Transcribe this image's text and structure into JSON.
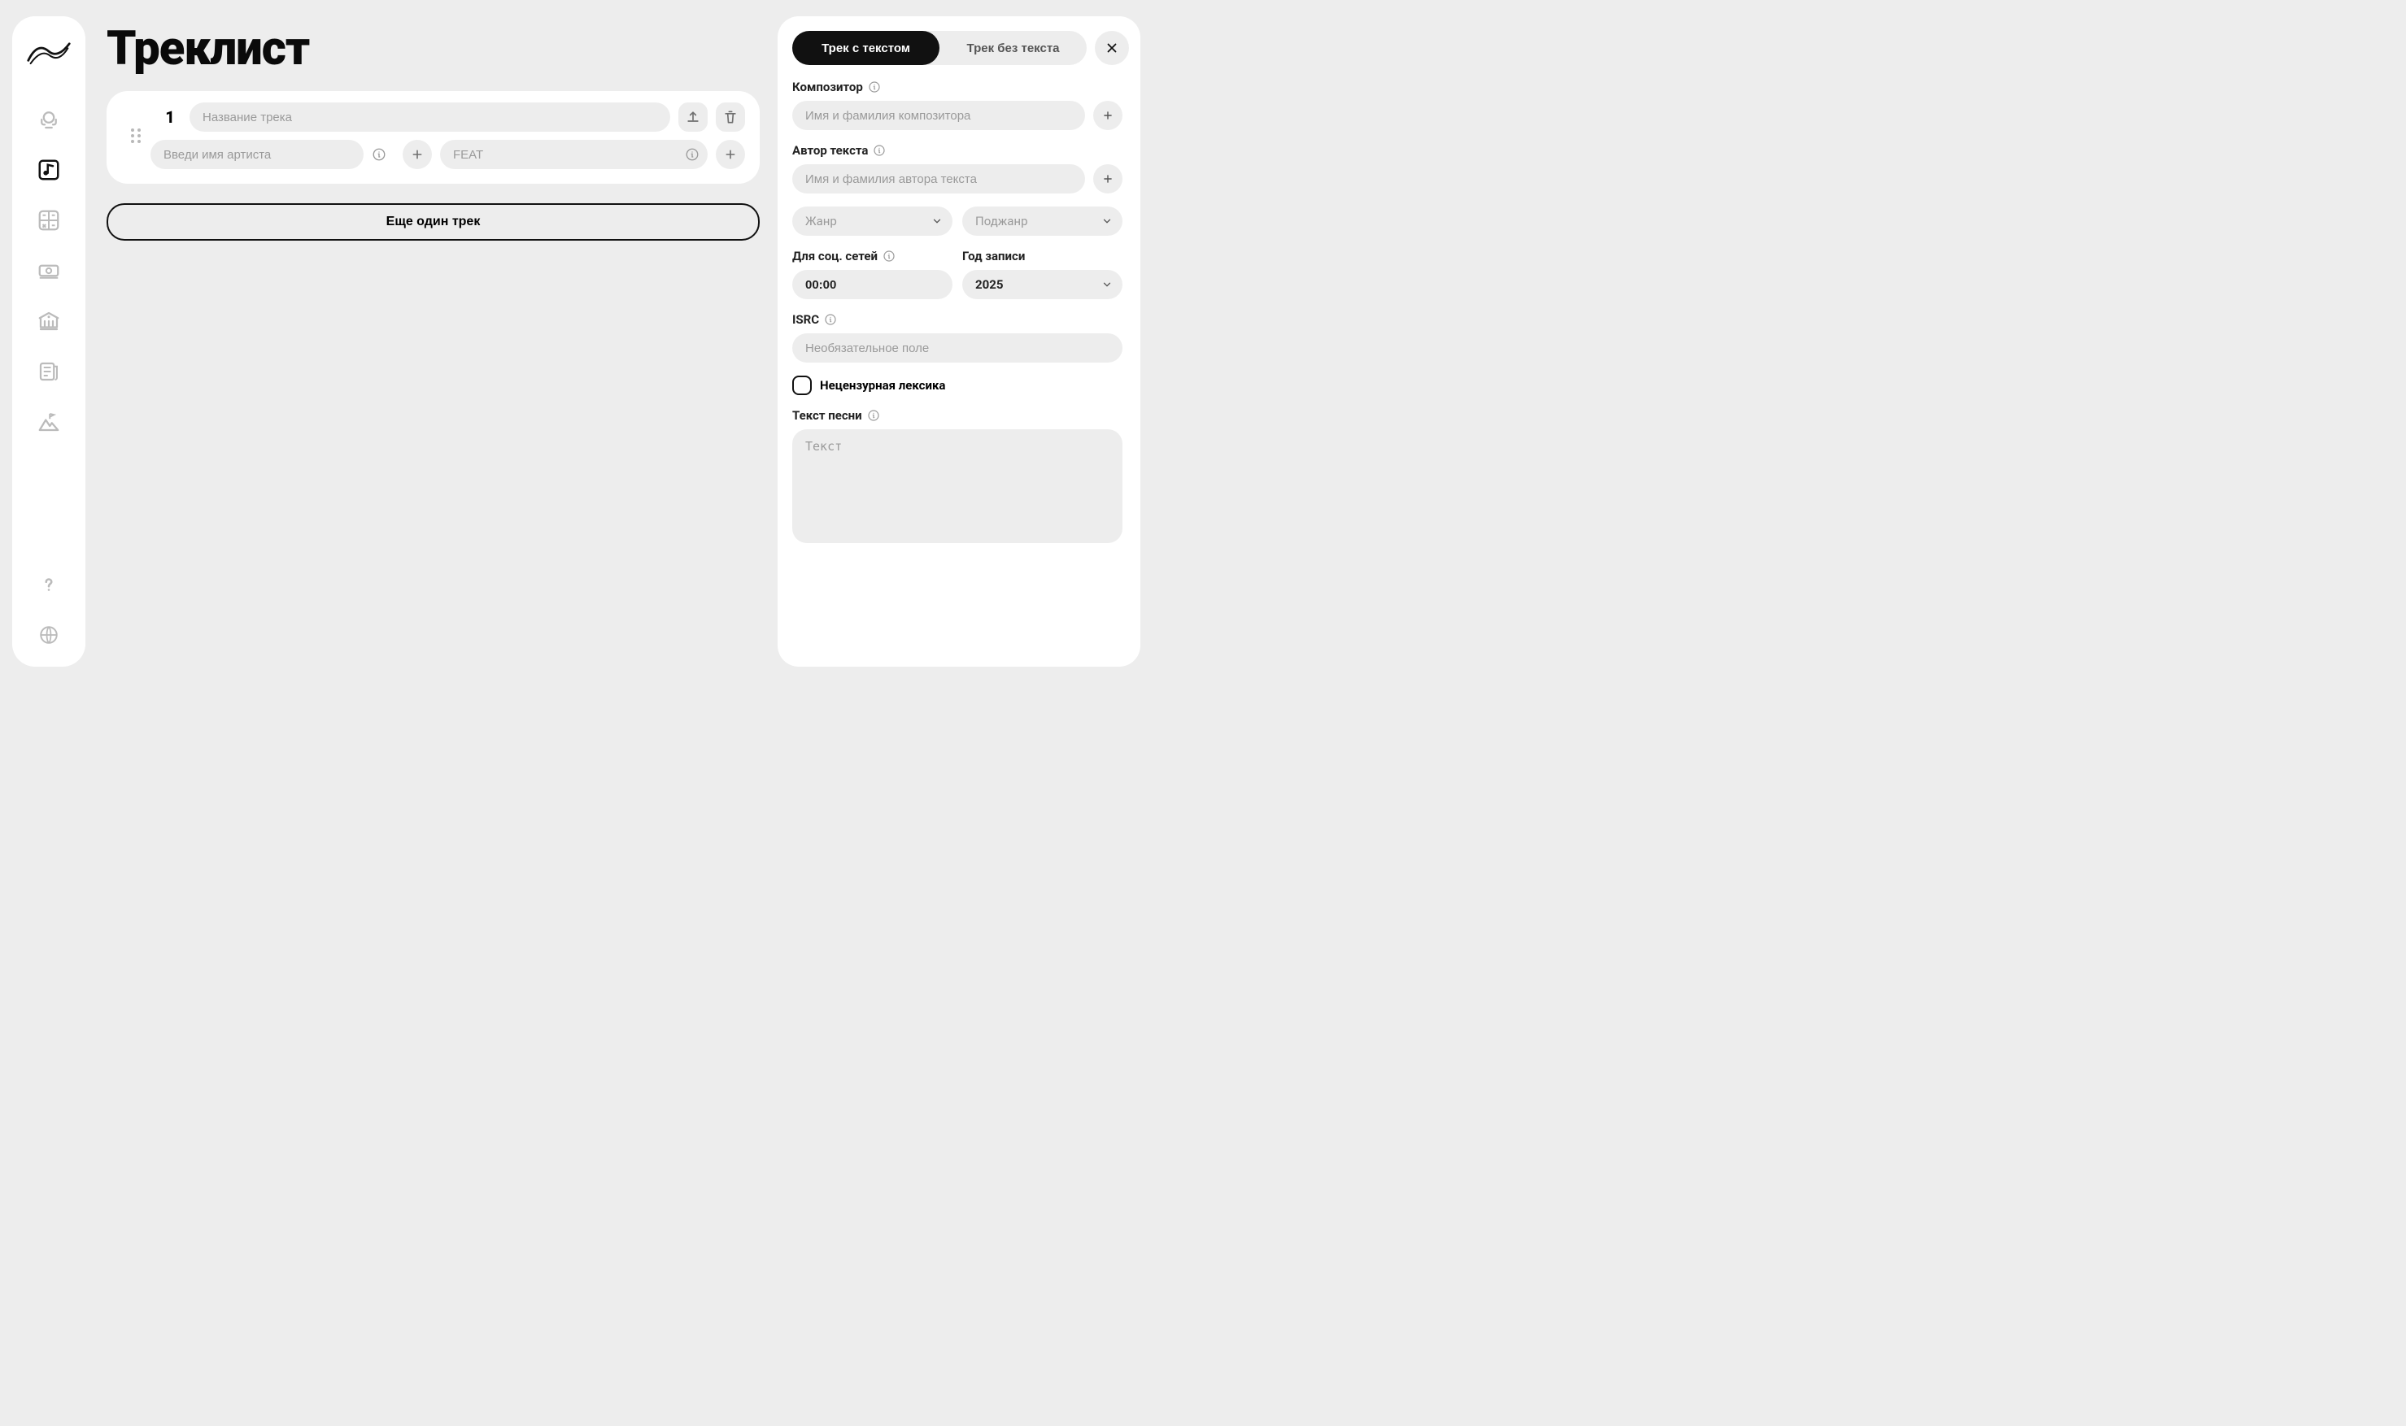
{
  "page": {
    "title": "Треклист"
  },
  "track": {
    "number": "1",
    "title_placeholder": "Название трека",
    "artist_placeholder": "Введи имя артиста",
    "feat_placeholder": "FEAT"
  },
  "add_track_label": "Еще один трек",
  "tabs": {
    "with_text": "Трек с текстом",
    "without_text": "Трек без текста"
  },
  "panel": {
    "composer_label": "Композитор",
    "composer_placeholder": "Имя и фамилия композитора",
    "lyricist_label": "Автор текста",
    "lyricist_placeholder": "Имя и фамилия автора текста",
    "genre_placeholder": "Жанр",
    "subgenre_placeholder": "Поджанр",
    "social_label": "Для соц. сетей",
    "social_value": "00:00",
    "year_label": "Год записи",
    "year_value": "2025",
    "isrc_label": "ISRC",
    "isrc_placeholder": "Необязательное поле",
    "explicit_label": "Нецензурная лексика",
    "lyrics_label": "Текст песни",
    "lyrics_placeholder": "Текст"
  }
}
